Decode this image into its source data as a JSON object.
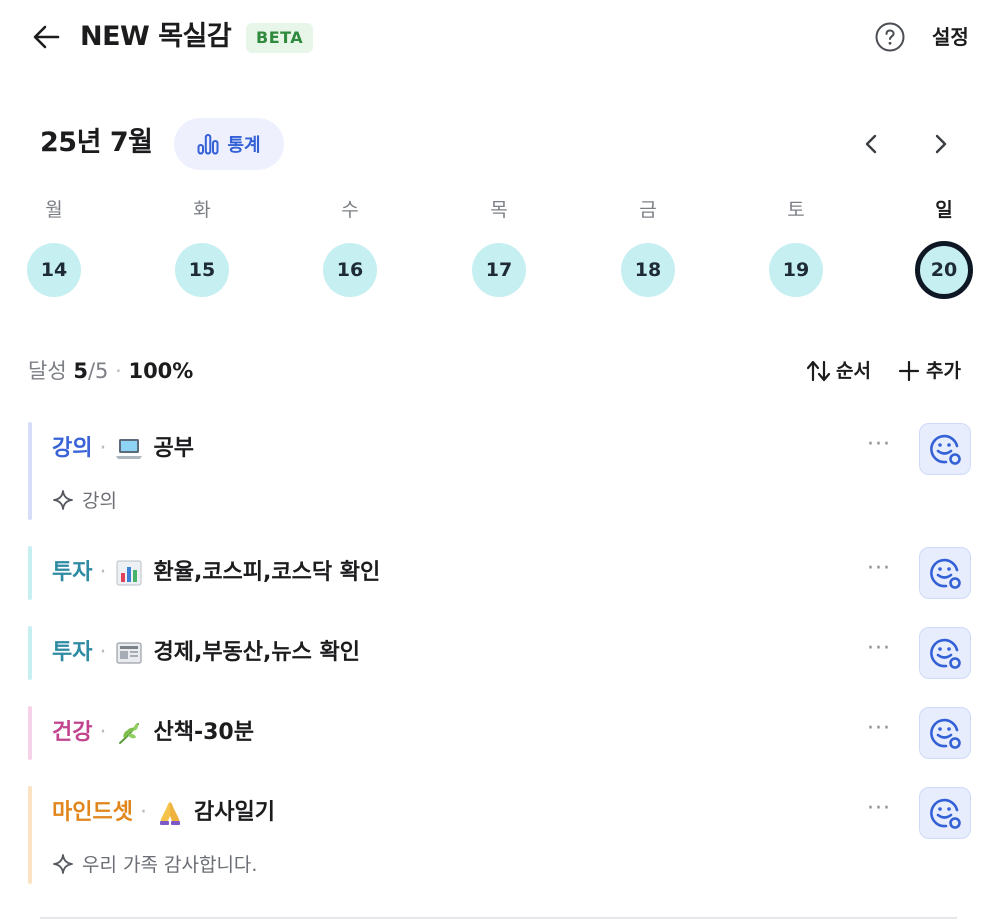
{
  "header": {
    "title": "NEW 목실감",
    "badge": "BETA",
    "settings_label": "설정",
    "icons": {
      "back": "arrow-left-icon",
      "help": "question-circle-icon"
    }
  },
  "calendar": {
    "month_label": "25년 7월",
    "stats_label": "통계",
    "weekdays": [
      "월",
      "화",
      "수",
      "목",
      "금",
      "토",
      "일"
    ],
    "days": [
      "14",
      "15",
      "16",
      "17",
      "18",
      "19",
      "20"
    ],
    "selected_day": "20",
    "colors": {
      "day_bg": "#c6eff2",
      "selected_ring": "#0e1724",
      "stats_accent": "#3561d6"
    }
  },
  "summary": {
    "label": "달성",
    "done": "5",
    "total": "/5",
    "separator": "·",
    "percent": "100%",
    "order_label": "순서",
    "add_label": "추가"
  },
  "tasks": [
    {
      "category": "강의",
      "emoji": "laptop",
      "name": "공부",
      "memo": "강의",
      "color": "#3a63d8",
      "bar": "#d6ddf8"
    },
    {
      "category": "투자",
      "emoji": "bar-chart",
      "name": "환율,코스피,코스닥 확인",
      "memo": "",
      "color": "#2f8ba3",
      "bar": "#c6eff2"
    },
    {
      "category": "투자",
      "emoji": "newspaper",
      "name": "경제,부동산,뉴스 확인",
      "memo": "",
      "color": "#2f8ba3",
      "bar": "#c6eff2"
    },
    {
      "category": "건강",
      "emoji": "herb",
      "name": "산책-30분",
      "memo": "",
      "color": "#c2448f",
      "bar": "#f6d2e8"
    },
    {
      "category": "마인드셋",
      "emoji": "folded-hands",
      "name": "감사일기",
      "memo": "우리 가족 감사합니다.",
      "color": "#e1861c",
      "bar": "#fbe2c2"
    }
  ],
  "task_separator": "·",
  "more_label": "···"
}
